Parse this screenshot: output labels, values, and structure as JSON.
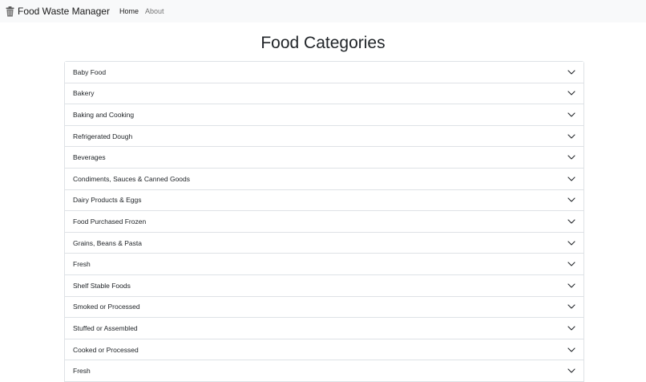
{
  "navbar": {
    "brand": "Food Waste Manager",
    "brand_icon": "trash-can-icon",
    "links": [
      {
        "label": "Home",
        "active": true
      },
      {
        "label": "About",
        "active": false
      }
    ]
  },
  "page": {
    "title": "Food Categories"
  },
  "categories": [
    "Baby Food",
    "Bakery",
    "Baking and Cooking",
    "Refrigerated Dough",
    "Beverages",
    "Condiments, Sauces & Canned Goods",
    "Dairy Products & Eggs",
    "Food Purchased Frozen",
    "Grains, Beans & Pasta",
    "Fresh",
    "Shelf Stable Foods",
    "Smoked or Processed",
    "Stuffed or Assembled",
    "Cooked or Processed",
    "Fresh"
  ],
  "icons": {
    "expand": "chevron-down-icon"
  },
  "colors": {
    "navbar_bg": "#f8f9fa",
    "border": "#dee2e6",
    "text": "#212529"
  }
}
